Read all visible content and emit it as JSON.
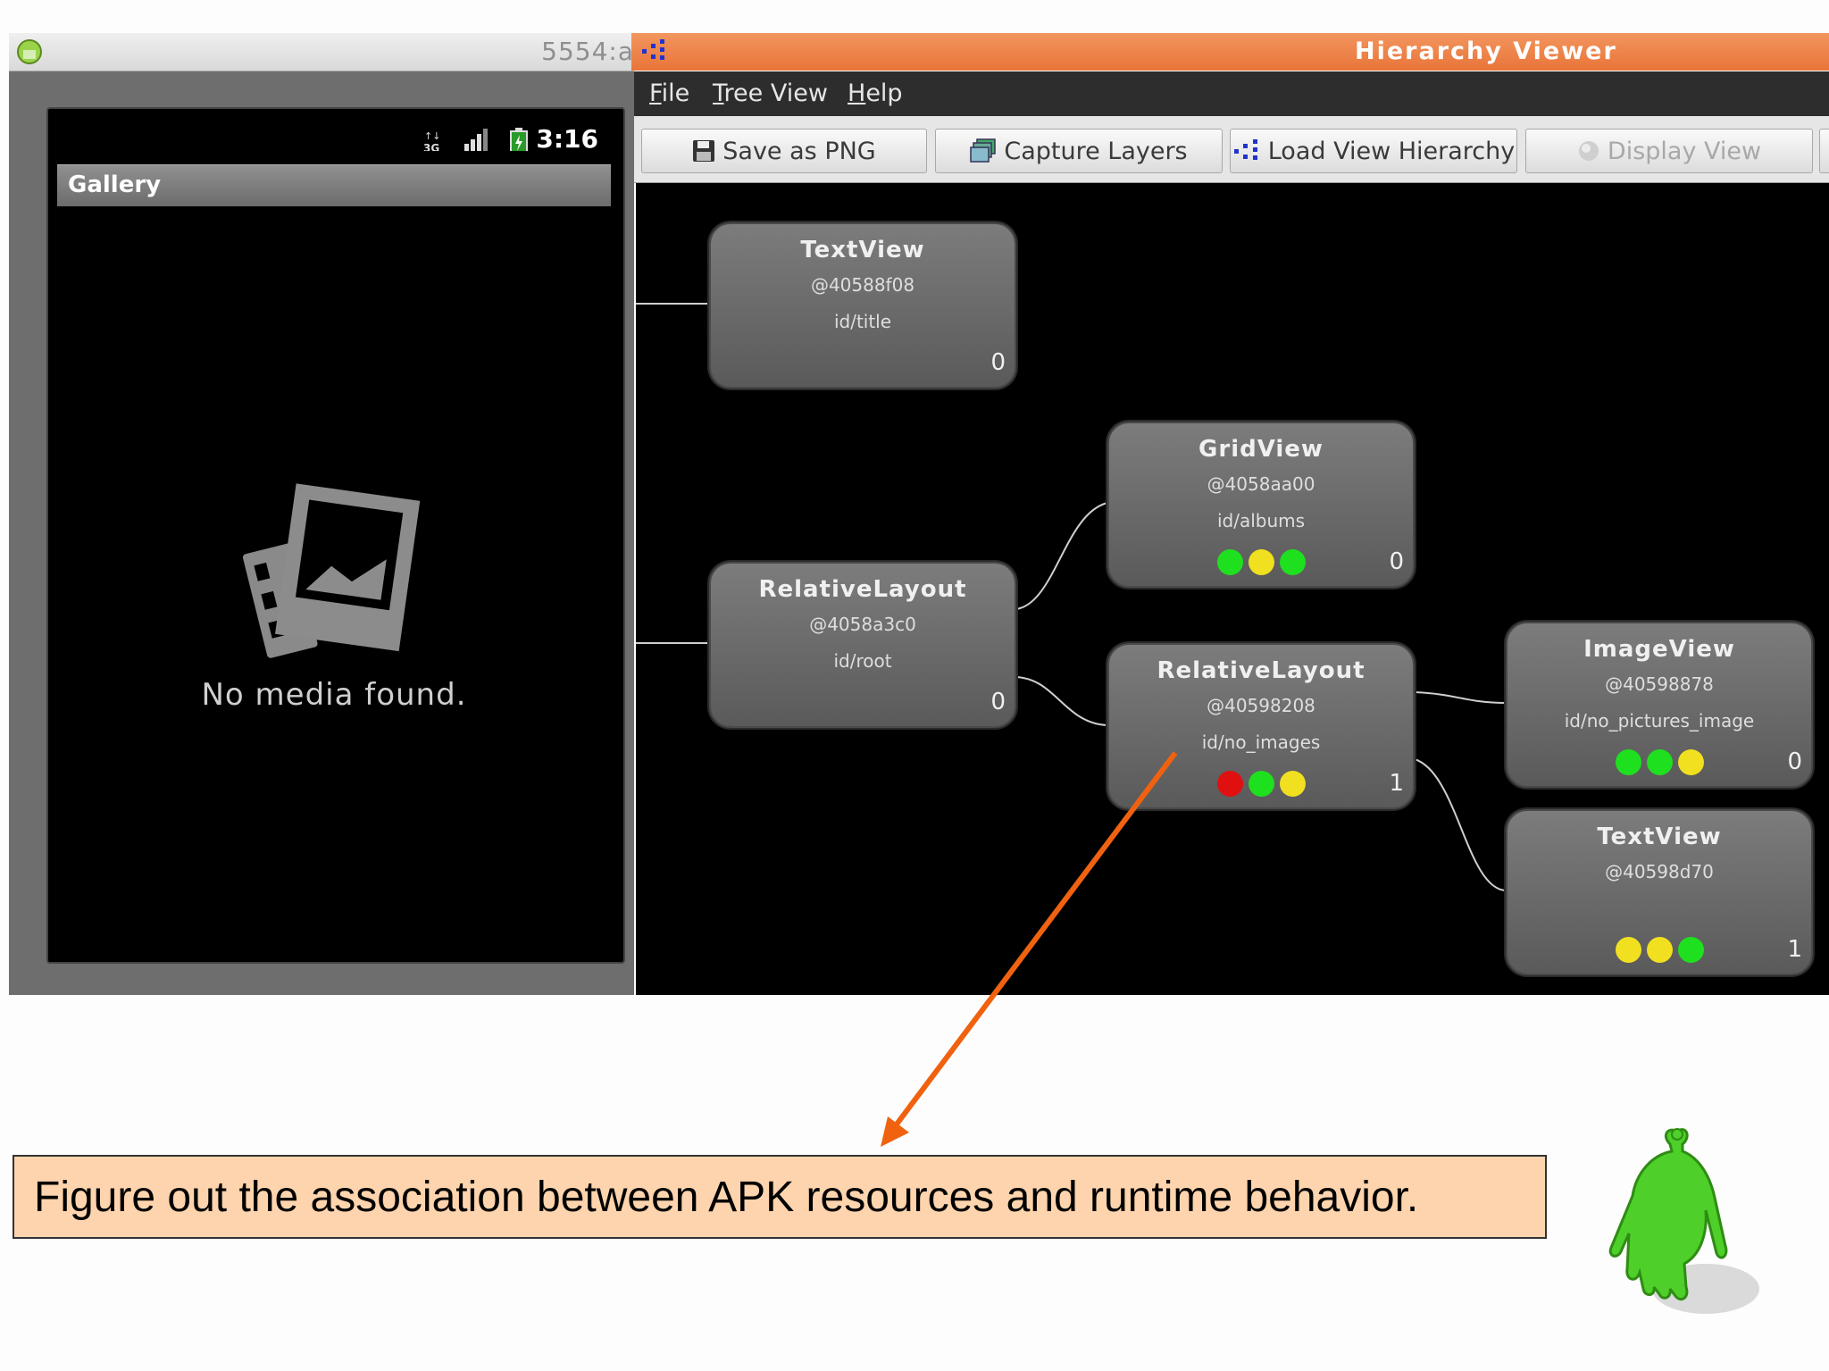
{
  "emulator": {
    "port_label": "5554:a",
    "status_time": "3:16",
    "app_title": "Gallery",
    "empty_message": "No media found."
  },
  "hierarchy_viewer": {
    "title": "Hierarchy Viewer",
    "menu": [
      {
        "mnemonic": "F",
        "rest": "ile"
      },
      {
        "mnemonic": "T",
        "rest": "ree View"
      },
      {
        "mnemonic": "H",
        "rest": "elp"
      }
    ],
    "toolbar": {
      "save_png": "Save as PNG",
      "capture_layers": "Capture Layers",
      "load_view_hierarchy": "Load View Hierarchy",
      "display_view": "Display View"
    },
    "nodes": [
      {
        "title": "TextView",
        "address": "@40588f08",
        "id": "id/title",
        "count": "0",
        "dots": []
      },
      {
        "title": "RelativeLayout",
        "address": "@4058a3c0",
        "id": "id/root",
        "count": "0",
        "dots": []
      },
      {
        "title": "GridView",
        "address": "@4058aa00",
        "id": "id/albums",
        "count": "0",
        "dots": [
          "#1fe01f",
          "#f0e020",
          "#1fe01f"
        ]
      },
      {
        "title": "RelativeLayout",
        "address": "@40598208",
        "id": "id/no_images",
        "count": "1",
        "dots": [
          "#e01010",
          "#1fe01f",
          "#f0e020"
        ]
      },
      {
        "title": "ImageView",
        "address": "@40598878",
        "id": "id/no_pictures_image",
        "count": "0",
        "dots": [
          "#1fe01f",
          "#1fe01f",
          "#f0e020"
        ]
      },
      {
        "title": "TextView",
        "address": "@40598d70",
        "id": "",
        "count": "1",
        "dots": [
          "#f0e020",
          "#f0e020",
          "#1fe01f"
        ]
      }
    ]
  },
  "caption": "Figure out the association between APK resources and runtime behavior.",
  "colors": {
    "hv_titlebar": "#ec7d45",
    "arrow": "#f0620f",
    "caption_bg": "#fdd4ad",
    "mascot": "#4fcf2a"
  }
}
